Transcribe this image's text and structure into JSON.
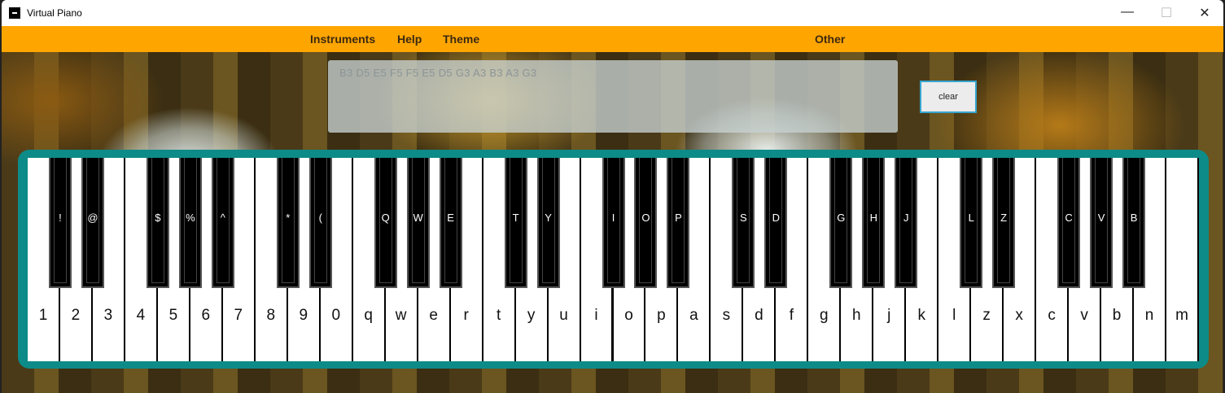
{
  "window": {
    "title": "Virtual Piano",
    "minimize": "—",
    "maximize": "☐",
    "close": "✕"
  },
  "menu": {
    "instruments": "Instruments",
    "help": "Help",
    "theme": "Theme",
    "other": "Other"
  },
  "notes_display": "B3 D5 E5 F5 F5 E5 D5 G3 A3 B3 A3 G3",
  "clear_label": "clear",
  "colors": {
    "menubar": "#FFA500",
    "frame": "#0d8b88",
    "button_border": "#36a5cf"
  },
  "piano": {
    "white_keys": [
      "1",
      "2",
      "3",
      "4",
      "5",
      "6",
      "7",
      "8",
      "9",
      "0",
      "q",
      "w",
      "e",
      "r",
      "t",
      "y",
      "u",
      "i",
      "o",
      "p",
      "a",
      "s",
      "d",
      "f",
      "g",
      "h",
      "j",
      "k",
      "l",
      "z",
      "x",
      "c",
      "v",
      "b",
      "n",
      "m"
    ],
    "black_keys": [
      {
        "label": "!",
        "after": 0
      },
      {
        "label": "@",
        "after": 1
      },
      {
        "label": "$",
        "after": 3
      },
      {
        "label": "%",
        "after": 4
      },
      {
        "label": "^",
        "after": 5
      },
      {
        "label": "*",
        "after": 7
      },
      {
        "label": "(",
        "after": 8
      },
      {
        "label": "Q",
        "after": 10
      },
      {
        "label": "W",
        "after": 11
      },
      {
        "label": "E",
        "after": 12
      },
      {
        "label": "T",
        "after": 14
      },
      {
        "label": "Y",
        "after": 15
      },
      {
        "label": "I",
        "after": 17
      },
      {
        "label": "O",
        "after": 18
      },
      {
        "label": "P",
        "after": 19
      },
      {
        "label": "S",
        "after": 21
      },
      {
        "label": "D",
        "after": 22
      },
      {
        "label": "G",
        "after": 24
      },
      {
        "label": "H",
        "after": 25
      },
      {
        "label": "J",
        "after": 26
      },
      {
        "label": "L",
        "after": 28
      },
      {
        "label": "Z",
        "after": 29
      },
      {
        "label": "C",
        "after": 31
      },
      {
        "label": "V",
        "after": 32
      },
      {
        "label": "B",
        "after": 33
      }
    ]
  }
}
